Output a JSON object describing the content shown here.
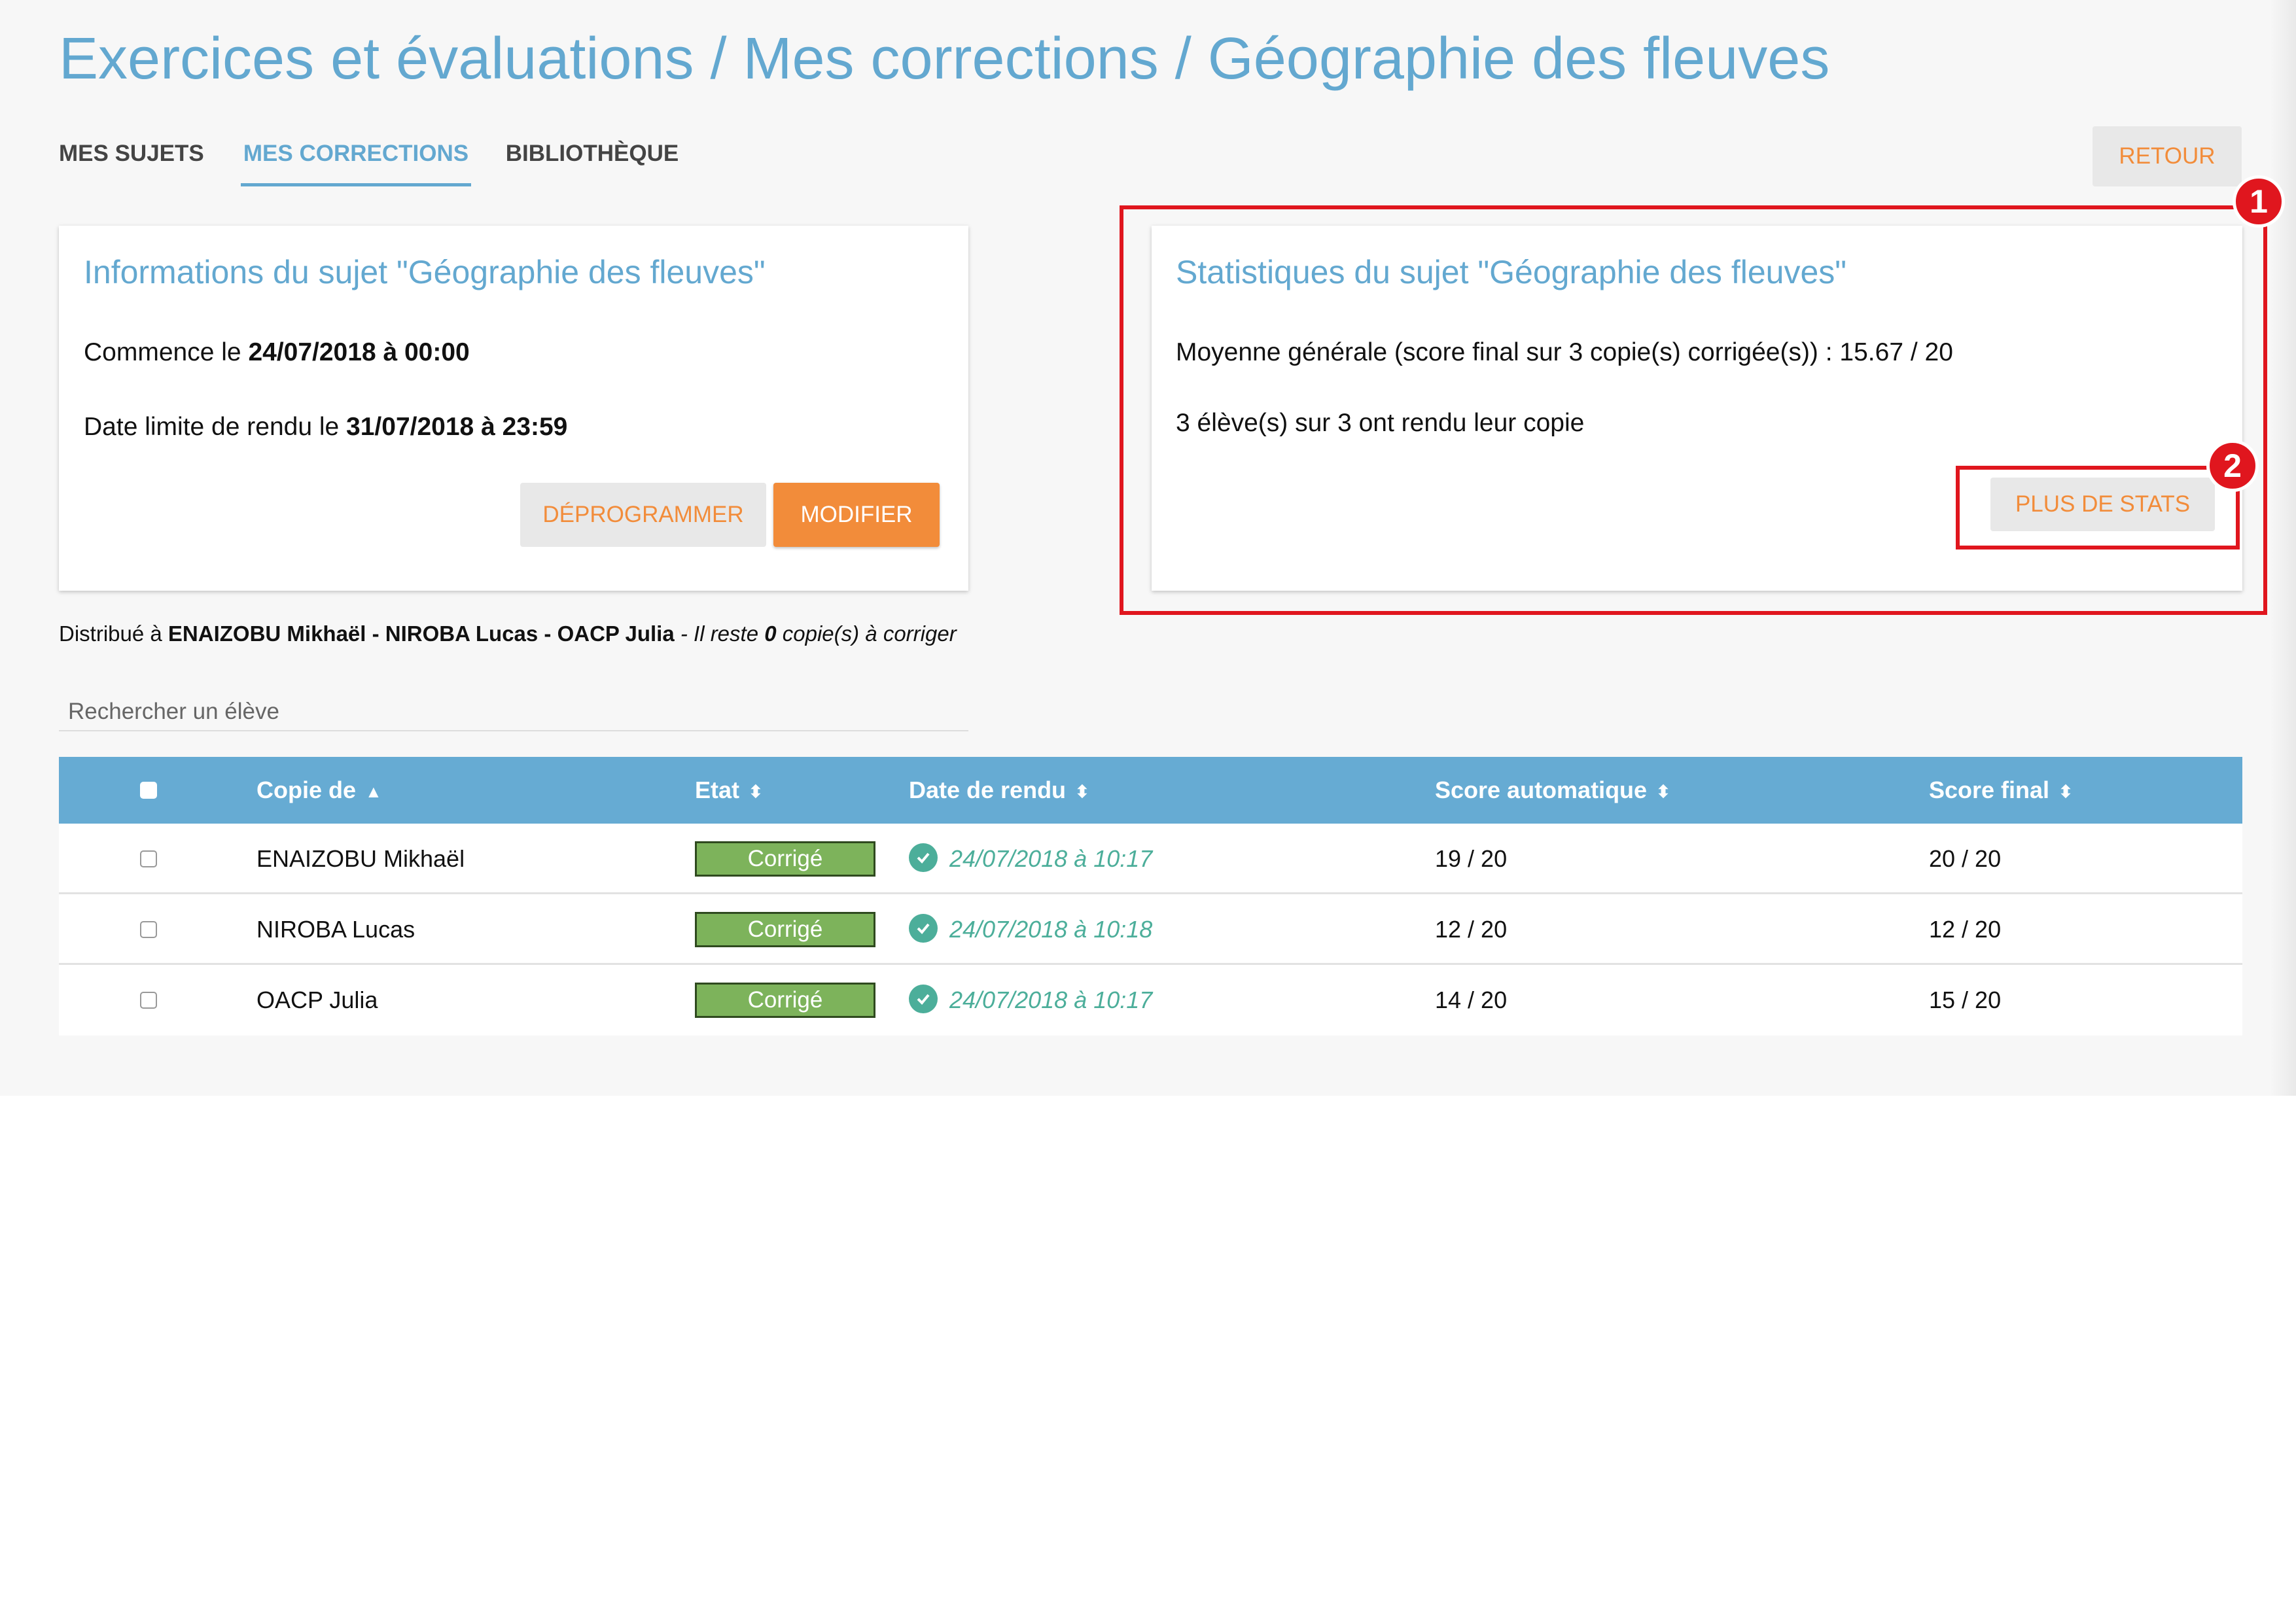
{
  "breadcrumb": "Exercices et évaluations / Mes corrections / Géographie des fleuves",
  "tabs": [
    {
      "label": "MES SUJETS"
    },
    {
      "label": "MES CORRECTIONS"
    },
    {
      "label": "BIBLIOTHÈQUE"
    }
  ],
  "back_button": "RETOUR",
  "info_card": {
    "title": "Informations du sujet \"Géographie des fleuves\"",
    "start_prefix": "Commence le ",
    "start_date": "24/07/2018 à 00:00",
    "deadline_prefix": "Date limite de rendu le ",
    "deadline_date": "31/07/2018 à 23:59",
    "unschedule_button": "DÉPROGRAMMER",
    "edit_button": "MODIFIER"
  },
  "stats_card": {
    "title": "Statistiques du sujet \"Géographie des fleuves\"",
    "average": "Moyenne générale (score final sur 3 copie(s) corrigée(s)) : 15.67 / 20",
    "submitted": "3 élève(s) sur 3 ont rendu leur copie",
    "more_stats_button": "PLUS DE STATS"
  },
  "annotations": {
    "badge1": "1",
    "badge2": "2"
  },
  "distribution": {
    "prefix": "Distribué à ",
    "students": "ENAIZOBU Mikhaël - NIROBA Lucas - OACP Julia",
    "remaining_prefix": " - Il reste ",
    "remaining_count": "0",
    "remaining_suffix": " copie(s) à corriger"
  },
  "search": {
    "placeholder": "Rechercher un élève"
  },
  "table": {
    "headers": {
      "copy": "Copie de",
      "state": "Etat",
      "date": "Date de rendu",
      "auto_score": "Score automatique",
      "final_score": "Score final"
    },
    "rows": [
      {
        "name": "ENAIZOBU Mikhaël",
        "state": "Corrigé",
        "date": "24/07/2018 à 10:17",
        "auto_score": "19 / 20",
        "final_score": "20 / 20"
      },
      {
        "name": "NIROBA Lucas",
        "state": "Corrigé",
        "date": "24/07/2018 à 10:18",
        "auto_score": "12 / 20",
        "final_score": "12 / 20"
      },
      {
        "name": "OACP Julia",
        "state": "Corrigé",
        "date": "24/07/2018 à 10:17",
        "auto_score": "14 / 20",
        "final_score": "15 / 20"
      }
    ]
  },
  "colors": {
    "accent_blue": "#63a8d0",
    "accent_orange": "#f28c3a",
    "status_green": "#7db35b",
    "check_teal": "#4cae9a",
    "highlight_red": "#e0161e"
  }
}
